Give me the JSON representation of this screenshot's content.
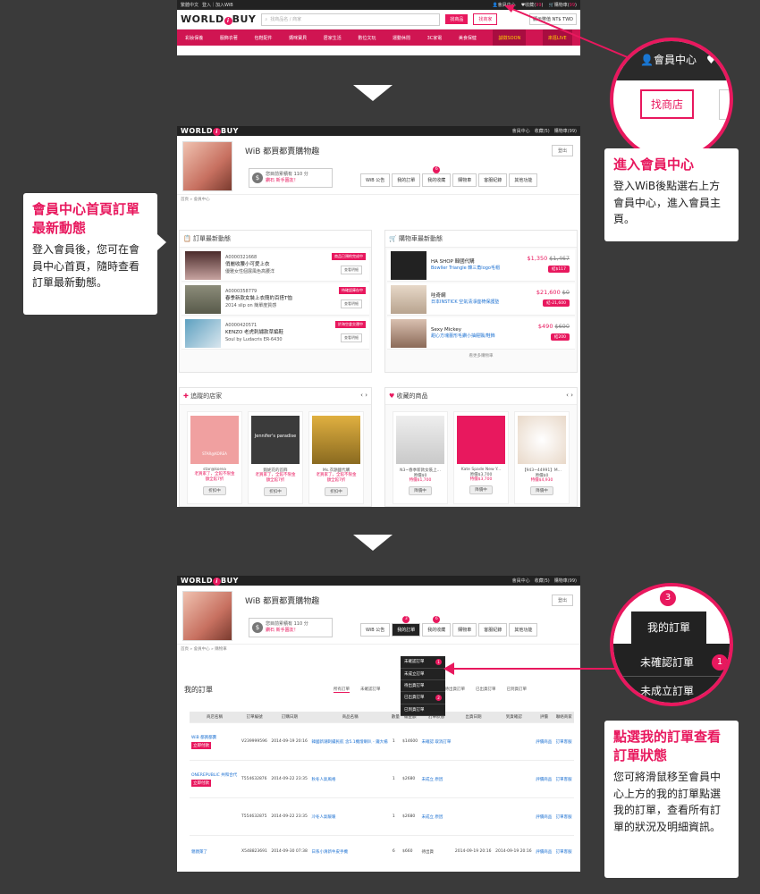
{
  "shot1": {
    "lang": "繁體中文",
    "login": "登入｜加入WiB",
    "member_center": "會員中心",
    "fav_label": "收藏",
    "fav_count": "99",
    "cart_label": "購物車",
    "cart_count": "99",
    "logo_a": "WORLD",
    "logo_i": "i",
    "logo_b": "BUY",
    "search_placeholder": "找商品名 / 商家",
    "btn_search_product": "找商品",
    "btn_search_store": "找商家",
    "currency": "顯示幣值 NT$ TWD",
    "nav": [
      "彩妝保養",
      "服飾衣著",
      "包鞋配件",
      "媽咪寶貝",
      "居家生活",
      "數位文玩",
      "運動休閒",
      "3C家電",
      "美食保健"
    ],
    "nav_soon": "誠徵SOON",
    "nav_live": "來逛LIVE"
  },
  "zoom1": {
    "member_center": "會員中心",
    "fav": "收",
    "button": "找商店"
  },
  "card1": {
    "title": "進入會員中心",
    "body": "登入WiB後點選右上方會員中心，進入會員主頁。"
  },
  "card2": {
    "title": "會員中心首頁訂單最新動態",
    "body": "登入會員後，您可在會員中心首頁，隨時查看訂單最新動態。"
  },
  "card3": {
    "title": "點選我的訂單查看訂單狀態",
    "body": "您可將滑鼠移至會員中心上方的我的訂單點選我的訂單，查看所有訂單的狀況及明細資訊。"
  },
  "shot2": {
    "member_center": "會員中心",
    "fav": "收藏(5)",
    "cart": "購物車(99)",
    "page_title": "WiB 都買都賣購物趣",
    "logout": "登出",
    "coupon_line1": "您目前累積有 110 分",
    "coupon_line2": "鑽石 新手園友！",
    "tabs": [
      "WiB 公告",
      "我的訂單",
      "我的收藏",
      "購物車",
      "客服紀錄",
      "其他功能"
    ],
    "tab_badge": "6",
    "crumb": "首頁 » 會員中心",
    "orders_title": "訂單最新動態",
    "orders": [
      {
        "id": "A0000321668",
        "name": "俏麗收腰小可愛上衣",
        "sub": "優雅女性個展風色高腰洋",
        "status": "商品已預約完成中",
        "btn": "查看明細"
      },
      {
        "id": "A0000358779",
        "name": "春季新款女裝上衣簡約百搭T恤",
        "sub": "2014 slip on 簡單度質感",
        "status": "待確認庫存中",
        "btn": "查看明細"
      },
      {
        "id": "A0000420571",
        "name": "KENZO 老虎刺繡款草編鞋",
        "sub": "Soul by Ludacris ER-6430",
        "status": "於海空倉交運中",
        "btn": "查看明細"
      }
    ],
    "cart_title": "購物車最新動態",
    "cart_items": [
      {
        "store": "HA SHOP 韓國代購",
        "name": "Bowller Triangle 韓三角logo毛帽",
        "price": "$1,350",
        "old": "$1,467",
        "btn": "結$117"
      },
      {
        "store": "哇奇網",
        "name": "日本INSTICK 空氣清淨座椅保護墊",
        "price": "$21,600",
        "old": "$0",
        "btn": "結-21,600"
      },
      {
        "store": "Sexy Mickey",
        "name": "甜心方塊蕾形毛鑽小抽屜飄/鞋飾",
        "price": "$490",
        "old": "$690",
        "btn": "結200"
      }
    ],
    "cart_more": "看更多購物車",
    "stores_title": "追蹤的店家",
    "stores": [
      {
        "name": "star@korea",
        "promo1": "老買家了，全館不限金",
        "promo2": "額全館7折",
        "btn": "折扣中"
      },
      {
        "name": "甄妮花的首飾",
        "promo1": "老買家了，全館不限金",
        "promo2": "額全館7折",
        "btn": "折扣中"
      },
      {
        "name": "Ms.衣韻國代購",
        "promo1": "老買家了，全館不限金",
        "promo2": "額全館7折",
        "btn": "折扣中"
      }
    ],
    "fav_title": "收藏的商品",
    "favs": [
      {
        "name": "N3~春季新款女裝上...",
        "p1": "原價$0",
        "p2": "特價$1,700",
        "btn": "降價中"
      },
      {
        "name": "Kate Spade New Y...",
        "p1": "原價$3,700",
        "p2": "特價$3,700",
        "btn": "降價中"
      },
      {
        "name": "【943~44991】M...",
        "p1": "原價$0",
        "p2": "特價$4,930",
        "btn": "降價中"
      }
    ],
    "store2_label": "Jennifer's paradise",
    "store1_label": "STAR@KOREA"
  },
  "shot3": {
    "member_center": "會員中心",
    "fav": "收藏(5)",
    "cart": "購物車(99)",
    "page_title": "WiB 都買都賣購物趣",
    "logout": "登出",
    "coupon_line1": "您目前累積有 110 分",
    "coupon_line2": "鑽石 新手園友！",
    "tabs": [
      "WiB 公告",
      "我的訂單",
      "我的收藏",
      "購物車",
      "客服紀錄",
      "其他功能"
    ],
    "tab_badge_orders": "3",
    "tab_badge_fav": "6",
    "crumb": "首頁 » 會員中心 » 購物車",
    "section_title": "我的訂單",
    "subtabs": [
      "所有訂單",
      "未確認訂單",
      "待出貨訂單",
      "已出貨訂單",
      "已到貨訂單"
    ],
    "dropdown": [
      {
        "label": "未確認訂單",
        "badge": "1"
      },
      {
        "label": "未成立訂單",
        "badge": ""
      },
      {
        "label": "待出貨訂單",
        "badge": ""
      },
      {
        "label": "已出貨訂單",
        "badge": "2"
      },
      {
        "label": "已到貨訂單",
        "badge": ""
      }
    ],
    "headers": [
      "商店名稱",
      "訂單編號",
      "訂購日期",
      "商品名稱",
      "數量",
      "總金額",
      "訂單狀態",
      "出貨日期",
      "到貨確認",
      "評價",
      "聯絡商家"
    ],
    "rows": [
      {
        "store": "WiB 都買都賣",
        "pay": "立即付款",
        "no": "V239999596",
        "date": "2014-09-19 20:16",
        "item": "韓國新潮刺繡民航 含5.1機燈喇叭 - 鐵大楊",
        "qty": "1",
        "amt": "$14600",
        "status": "未確認 取消訂單",
        "ship": "",
        "arr": "",
        "rate": "評價商品",
        "contact": "訂單客服"
      },
      {
        "store": "ONEREPUBLIC 共和合代",
        "pay": "立即付款",
        "no": "T554632876",
        "date": "2014-09-22 23:35",
        "item": "秋冬人氣風格",
        "qty": "1",
        "amt": "$2680",
        "status": "未成立 原因",
        "ship": "",
        "arr": "",
        "rate": "評價商品",
        "contact": "訂單客服"
      },
      {
        "store": "",
        "pay": "",
        "no": "T554632875",
        "date": "2014-09-22 23:35",
        "item": "冷冬人氣暖暖",
        "qty": "1",
        "amt": "$2680",
        "status": "未成立 原因",
        "ship": "",
        "arr": "",
        "rate": "評價商品",
        "contact": "訂單客服"
      },
      {
        "store": "親親萊了",
        "pay": "",
        "no": "X548823691",
        "date": "2014-09-30 07:38",
        "item": "日系小清新牛皮手機",
        "qty": "6",
        "amt": "$660",
        "status": "待出貨",
        "ship": "2014-09-19 20:16",
        "arr": "2014-09-19 20:16",
        "rate": "評價商品",
        "contact": "訂單客服"
      }
    ]
  },
  "zoom3": {
    "badge": "3",
    "tab": "我的訂單",
    "item1": "未確認訂單",
    "item1_badge": "1",
    "item2": "未成立訂單"
  },
  "colors": {
    "accent": "#e8185e",
    "dark": "#222222",
    "bg": "#3a3a3a"
  }
}
